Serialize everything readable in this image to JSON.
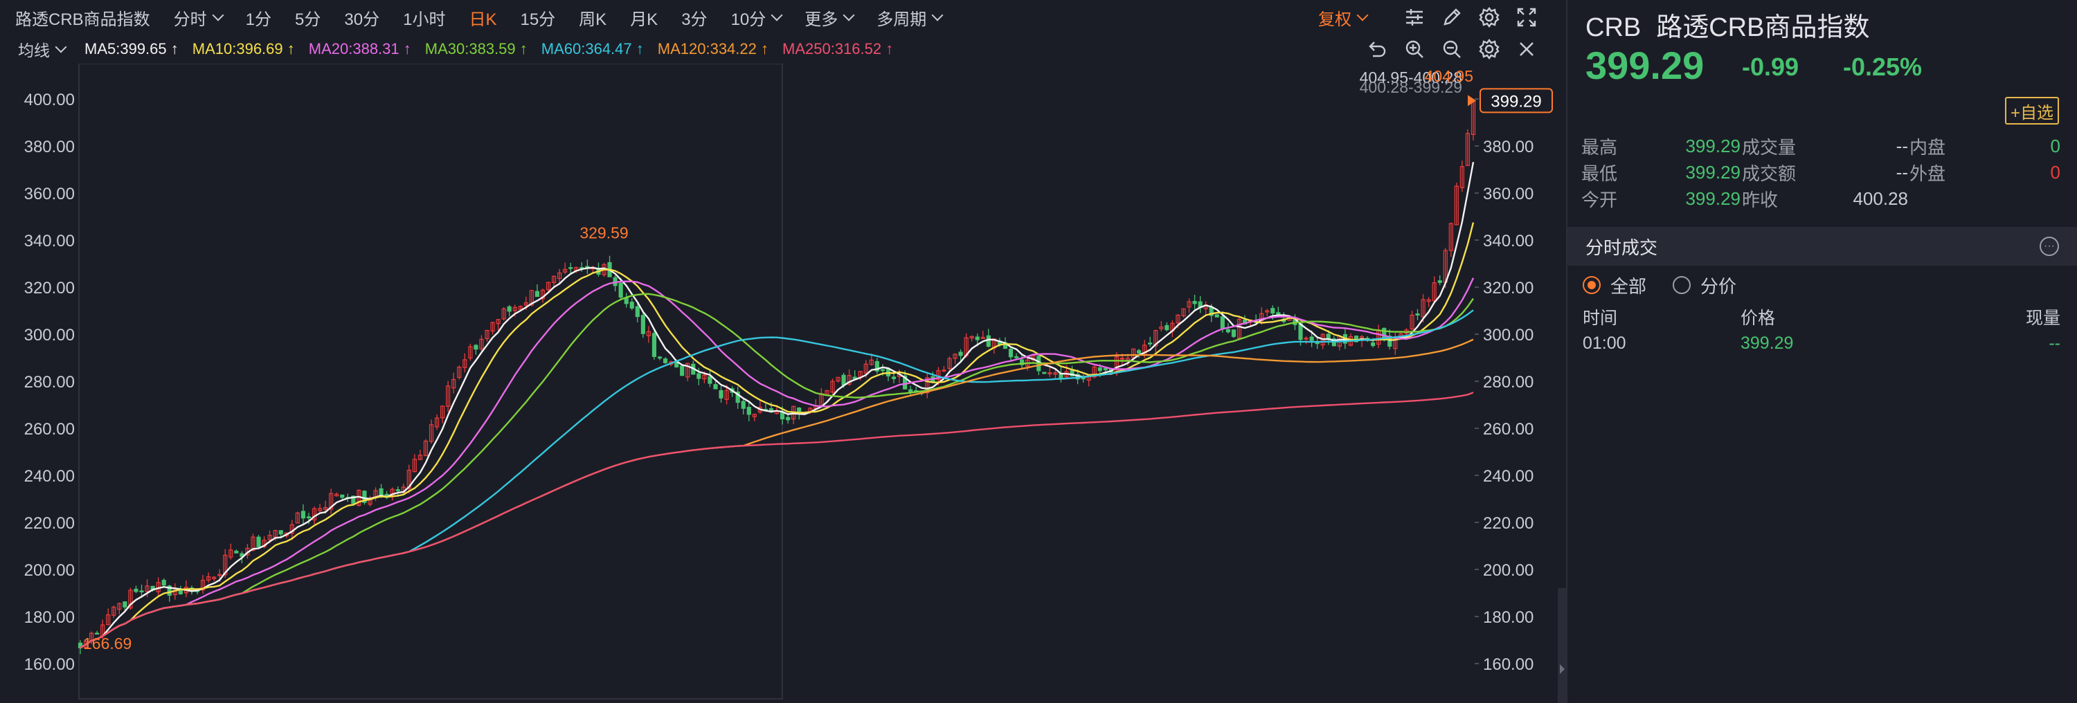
{
  "toolbar": {
    "index_name": "路透CRB商品指数",
    "period_items": [
      {
        "label": "分时",
        "dropdown": true,
        "active": false
      },
      {
        "label": "1分",
        "dropdown": false,
        "active": false
      },
      {
        "label": "5分",
        "dropdown": false,
        "active": false
      },
      {
        "label": "30分",
        "dropdown": false,
        "active": false
      },
      {
        "label": "1小时",
        "dropdown": false,
        "active": false
      },
      {
        "label": "日K",
        "dropdown": false,
        "active": true
      },
      {
        "label": "15分",
        "dropdown": false,
        "active": false
      },
      {
        "label": "周K",
        "dropdown": false,
        "active": false
      },
      {
        "label": "月K",
        "dropdown": false,
        "active": false
      },
      {
        "label": "3分",
        "dropdown": false,
        "active": false
      },
      {
        "label": "10分",
        "dropdown": true,
        "active": false
      },
      {
        "label": "更多",
        "dropdown": true,
        "active": false
      },
      {
        "label": "多周期",
        "dropdown": true,
        "active": false
      }
    ],
    "adjust_label": "复权",
    "icons": [
      "sliders-icon",
      "pencil-icon",
      "gear-icon",
      "expand-icon"
    ]
  },
  "ma_bar": {
    "avg_label": "均线",
    "items": [
      {
        "text": "MA5:399.65",
        "color": "#f3f3f3"
      },
      {
        "text": "MA10:396.69",
        "color": "#f5e04b"
      },
      {
        "text": "MA20:388.31",
        "color": "#e86be8"
      },
      {
        "text": "MA30:383.59",
        "color": "#7fd13b"
      },
      {
        "text": "MA60:364.47",
        "color": "#36c7de"
      },
      {
        "text": "MA120:334.22",
        "color": "#f59a33"
      },
      {
        "text": "MA250:316.52",
        "color": "#f0506e"
      }
    ],
    "icons": [
      "undo-icon",
      "zoom-in-icon",
      "zoom-out-icon",
      "gear-icon",
      "close-icon"
    ]
  },
  "chart_data": {
    "type": "line",
    "ylim": [
      145,
      415
    ],
    "y_ticks": [
      "400.00",
      "380.00",
      "360.00",
      "340.00",
      "320.00",
      "300.00",
      "280.00",
      "260.00",
      "240.00",
      "220.00",
      "200.00",
      "180.00",
      "160.00"
    ],
    "y_tick_values": [
      400,
      380,
      360,
      340,
      320,
      300,
      280,
      260,
      240,
      220,
      200,
      180,
      160
    ],
    "n_points": 251,
    "x_anchor_index": [
      0,
      6,
      12,
      20,
      28,
      38,
      46,
      52,
      58,
      66,
      74,
      84,
      94,
      104,
      110,
      118,
      126,
      134,
      142,
      150,
      160,
      170,
      180,
      190,
      200,
      206,
      214,
      222,
      228,
      236,
      244,
      250
    ],
    "close_anchor_values": [
      166.7,
      184,
      193,
      191,
      207,
      219,
      232,
      230,
      235,
      278,
      305,
      322,
      329.6,
      290,
      283,
      271,
      264,
      276,
      289,
      276,
      299,
      289,
      281,
      292,
      313,
      301,
      309,
      296,
      299,
      298,
      322,
      399.3
    ],
    "high_label": "329.59",
    "high_index": 94,
    "low_label": "166.69",
    "low_index": 0,
    "last_value": 399.29,
    "last_label": "399.29",
    "top_annotations": [
      "404.95-400.28",
      "400.28-399.29",
      "404.95"
    ],
    "series": [
      {
        "name": "MA5",
        "color": "#f3f3f3",
        "period": 5
      },
      {
        "name": "MA10",
        "color": "#f5e04b",
        "period": 10
      },
      {
        "name": "MA20",
        "color": "#e86be8",
        "period": 20
      },
      {
        "name": "MA30",
        "color": "#7fd13b",
        "period": 30
      },
      {
        "name": "MA60",
        "color": "#36c7de",
        "period": 60
      },
      {
        "name": "MA120",
        "color": "#f59a33",
        "period": 120
      },
      {
        "name": "MA250",
        "color": "#f0506e",
        "period": 250
      }
    ]
  },
  "side": {
    "code": "CRB",
    "name": "路透CRB商品指数",
    "price": "399.29",
    "change": "-0.99",
    "pct": "-0.25%",
    "fav_label": "+自选",
    "stats": [
      [
        {
          "label": "最高",
          "value": "399.29",
          "color": "#47c270"
        },
        {
          "label": "成交量",
          "value": "--",
          "color": "#c9ccd3"
        },
        {
          "label": "内盘",
          "value": "0",
          "color": "#47c270"
        }
      ],
      [
        {
          "label": "最低",
          "value": "399.29",
          "color": "#47c270"
        },
        {
          "label": "成交额",
          "value": "--",
          "color": "#c9ccd3"
        },
        {
          "label": "外盘",
          "value": "0",
          "color": "#ee3b3b"
        }
      ],
      [
        {
          "label": "今开",
          "value": "399.29",
          "color": "#47c270"
        },
        {
          "label": "昨收",
          "value": "400.28",
          "color": "#c9ccd3"
        }
      ]
    ],
    "trades_title": "分时成交",
    "radio_all": "全部",
    "radio_price": "分价",
    "col_time": "时间",
    "col_price": "价格",
    "col_vol": "现量",
    "rows": [
      {
        "time": "01:00",
        "price": "399.29",
        "vol": "--"
      }
    ]
  },
  "colors": {
    "up": "#ee3b3b",
    "down": "#47c270",
    "accent": "#ff7a2f",
    "bg": "#1b1d26"
  }
}
